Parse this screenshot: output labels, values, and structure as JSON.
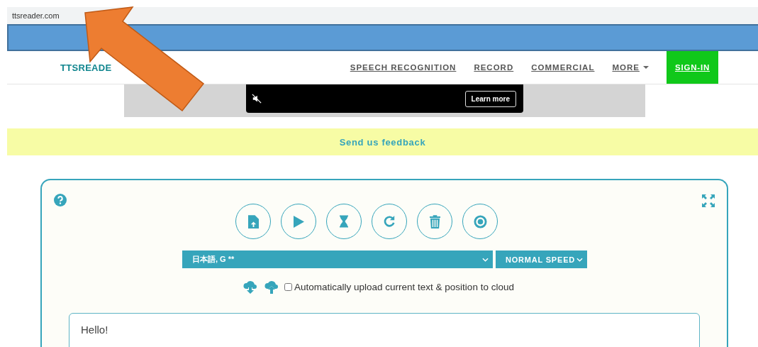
{
  "browser": {
    "address": "ttsreader.com"
  },
  "header": {
    "logo": "TTSREADE",
    "nav": [
      {
        "label": "SPEECH RECOGNITION",
        "kind": "link"
      },
      {
        "label": "RECORD",
        "kind": "link"
      },
      {
        "label": "COMMERCIAL",
        "kind": "link"
      },
      {
        "label": "MORE",
        "kind": "dropdown"
      },
      {
        "label": "SIGN-IN",
        "kind": "button"
      }
    ]
  },
  "ad": {
    "button": "Learn more"
  },
  "feedback": {
    "label": "Send us feedback"
  },
  "player": {
    "toolbar": [
      {
        "kind": "upload-file"
      },
      {
        "kind": "play"
      },
      {
        "kind": "timer"
      },
      {
        "kind": "reload"
      },
      {
        "kind": "delete"
      },
      {
        "kind": "record"
      }
    ],
    "voice": "日本語, G **",
    "speed": "NORMAL SPEED",
    "auto_upload": {
      "label": "Automatically upload current text & position to cloud",
      "checked": false
    },
    "text": "Hello!"
  }
}
